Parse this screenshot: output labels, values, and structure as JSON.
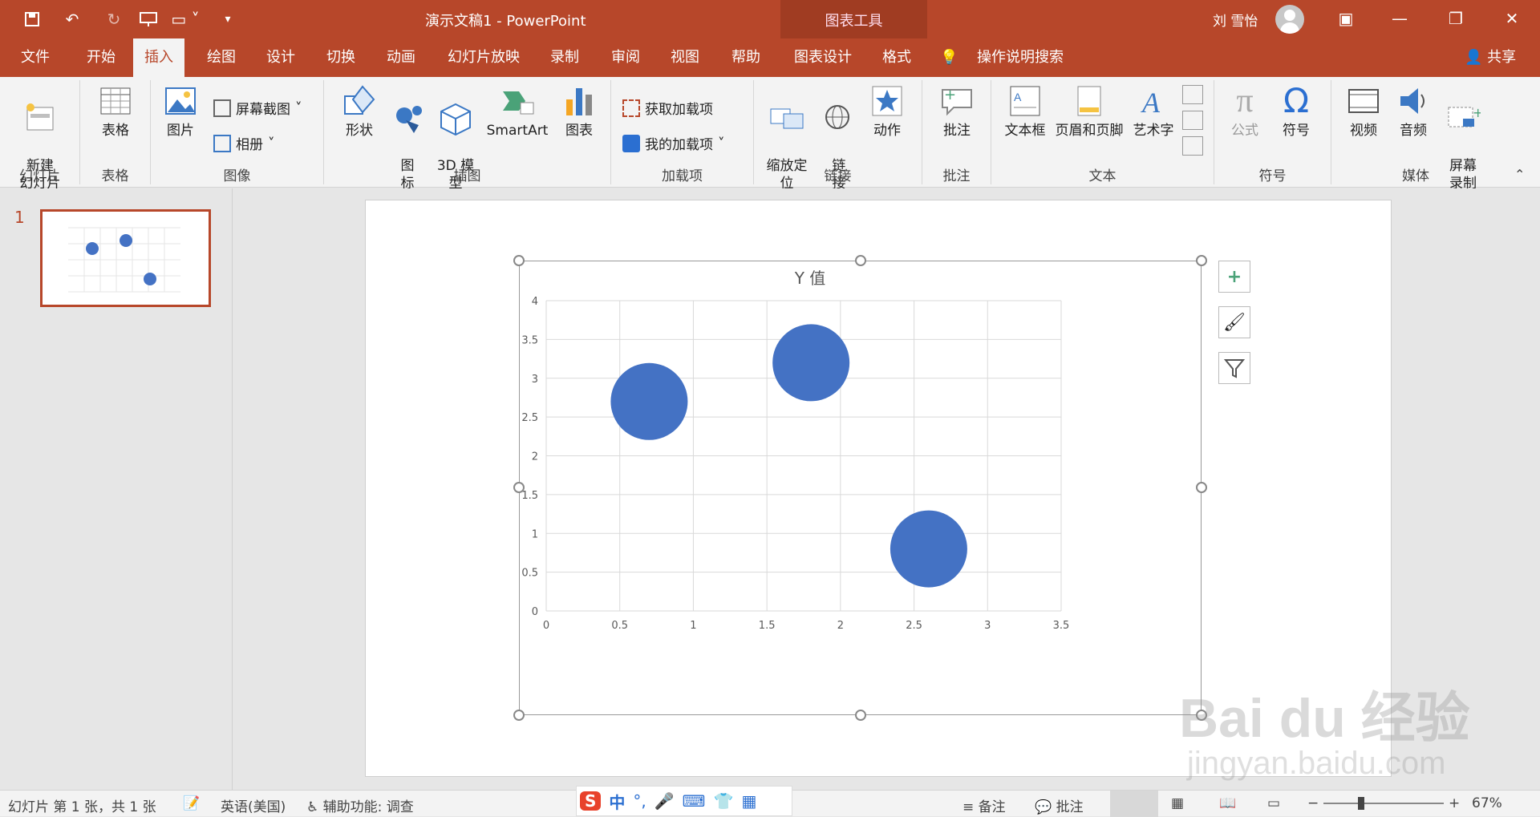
{
  "window": {
    "title": "演示文稿1  -  PowerPoint",
    "chart_tools": "图表工具",
    "user": "刘 雪怡"
  },
  "tabs": [
    "文件",
    "开始",
    "插入",
    "绘图",
    "设计",
    "切换",
    "动画",
    "幻灯片放映",
    "录制",
    "审阅",
    "视图",
    "帮助",
    "图表设计",
    "格式"
  ],
  "active_tab": "插入",
  "tell_me": "操作说明搜索",
  "share": "共享",
  "ribbon": {
    "slides": {
      "new_slide": "新建\n幻灯片",
      "group": "幻灯片"
    },
    "tables": {
      "table": "表格",
      "group": "表格"
    },
    "images": {
      "picture": "图片",
      "screenshot": "屏幕截图",
      "album": "相册",
      "group": "图像"
    },
    "illustrations": {
      "shapes": "形状",
      "icons": "图\n标",
      "model3d": "3D 模\n型",
      "smartart": "SmartArt",
      "chart": "图表",
      "group": "插图"
    },
    "addins": {
      "get": "获取加载项",
      "mine": "我的加载项",
      "group": "加载项"
    },
    "links": {
      "zoom": "缩放定\n位",
      "link": "链\n接",
      "action": "动作",
      "group": "链接"
    },
    "comments": {
      "comment": "批注",
      "group": "批注"
    },
    "text": {
      "textbox": "文本框",
      "header": "页眉和页脚",
      "wordart": "艺术字",
      "group": "文本"
    },
    "symbols": {
      "equation": "公式",
      "symbol": "符号",
      "group": "符号"
    },
    "media": {
      "video": "视频",
      "audio": "音频",
      "screenrec": "屏幕\n录制",
      "group": "媒体"
    }
  },
  "slide_panel": {
    "number": "1"
  },
  "status": {
    "slide": "幻灯片 第 1 张，共 1 张",
    "lang": "英语(美国)",
    "access": "辅助功能: 调查",
    "notes": "备注",
    "comments": "批注",
    "zoom": "67%"
  },
  "ime": {
    "mode": "中"
  },
  "watermark": {
    "line1": "Bai du 经验",
    "line2": "jingyan.baidu.com"
  },
  "colors": {
    "accent": "#b7472a",
    "bubble": "#4472c4"
  },
  "chart_data": {
    "type": "scatter",
    "title": "Y 值",
    "xlabel": "",
    "ylabel": "",
    "xlim": [
      0,
      3.5
    ],
    "ylim": [
      0,
      4
    ],
    "xticks": [
      "0",
      "0.5",
      "1",
      "1.5",
      "2",
      "2.5",
      "3",
      "3.5"
    ],
    "yticks": [
      "0",
      "0.5",
      "1",
      "1.5",
      "2",
      "2.5",
      "3",
      "3.5",
      "4"
    ],
    "grid": true,
    "points": [
      {
        "x": 0.7,
        "y": 2.7
      },
      {
        "x": 1.8,
        "y": 3.2
      },
      {
        "x": 2.6,
        "y": 0.8
      }
    ]
  }
}
